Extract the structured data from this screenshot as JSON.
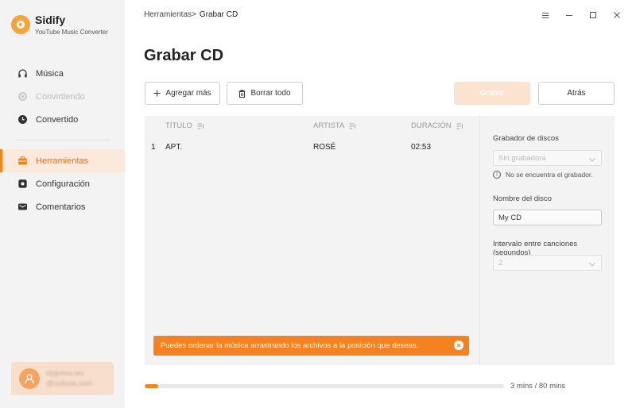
{
  "app": {
    "name": "Sidify",
    "subtitle": "YouTube Music Converter"
  },
  "sidebar": {
    "items": [
      {
        "label": "Música",
        "icon": "headphones-icon",
        "state": "normal"
      },
      {
        "label": "Convirtiendo",
        "icon": "sync-icon",
        "state": "disabled"
      },
      {
        "label": "Convertido",
        "icon": "clock-icon",
        "state": "normal"
      },
      {
        "label": "Herramientas",
        "icon": "toolbox-icon",
        "state": "active"
      },
      {
        "label": "Configuración",
        "icon": "gear-icon",
        "state": "normal"
      },
      {
        "label": "Comentarios",
        "icon": "mail-icon",
        "state": "normal"
      }
    ],
    "user": {
      "line1": "sipjehsa.wu",
      "line2": "@outlook.com"
    }
  },
  "breadcrumb": {
    "parent": "Herramientas",
    "separator": ">",
    "current": "Grabar CD"
  },
  "page": {
    "title": "Grabar CD"
  },
  "toolbar": {
    "add_label": "Agregar más",
    "clear_label": "Borrar todo",
    "burn_label": "Grabar",
    "back_label": "Atrás"
  },
  "table": {
    "columns": [
      "TÍTULO",
      "ARTISTA",
      "DURACIÓN"
    ],
    "rows": [
      {
        "index": "1",
        "title": "APT.",
        "artist": "ROSÉ",
        "duration": "02:53"
      }
    ]
  },
  "toast": {
    "message": "Puedes ordenar la música arrastrando los archivos a la posición que deseas."
  },
  "settings": {
    "burner_label": "Grabador de discos",
    "burner_value": "Sin grabadora",
    "burner_note": "No se encuentra el grabador.",
    "disc_name_label": "Nombre del disco",
    "disc_name_value": "My CD",
    "interval_label": "Intervalo entre canciones (segundos)",
    "interval_value": "2"
  },
  "progress": {
    "fraction": 0.0375,
    "text": "3 mins / 80 mins"
  },
  "colors": {
    "accent": "#f58220",
    "active_bg": "#fbe9dc",
    "burn_disabled": "#fce3d0"
  }
}
